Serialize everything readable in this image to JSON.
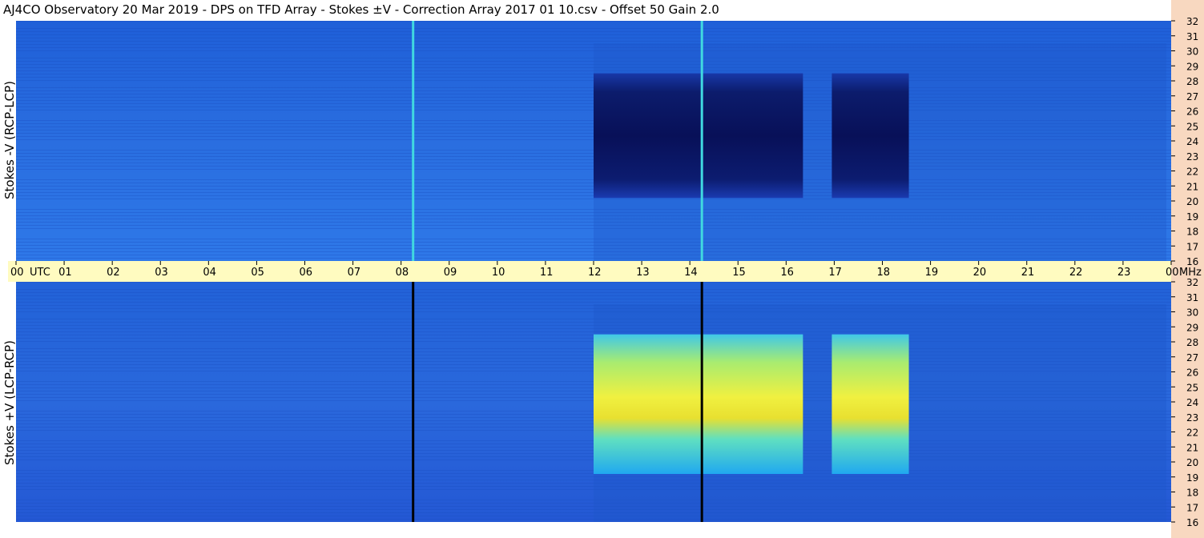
{
  "title": "AJ4CO Observatory  20 Mar 2019  -  DPS on TFD Array  -  Stokes ±V  -  Correction Array 2017 01 10.csv  -  Offset 50  Gain 2.0",
  "colors": {
    "background_blue": "#2a6ee0",
    "time_axis_band": "#fffbc0",
    "right_axis_strip": "#f8d8c0",
    "dark_event": "#0a1a5a",
    "yellow_event": "#f0e020"
  },
  "chart_data": {
    "type": "heatmap",
    "x_axis": {
      "label_unit": "UTC",
      "ticks": [
        "00",
        "01",
        "02",
        "03",
        "04",
        "05",
        "06",
        "07",
        "08",
        "09",
        "10",
        "11",
        "12",
        "13",
        "14",
        "15",
        "16",
        "17",
        "18",
        "19",
        "20",
        "21",
        "22",
        "23",
        "00"
      ],
      "range_hours": [
        0,
        24
      ]
    },
    "y_axis": {
      "unit": "MHz",
      "ticks": [
        "32",
        "31",
        "30",
        "29",
        "28",
        "27",
        "26",
        "25",
        "24",
        "23",
        "22",
        "21",
        "20",
        "19",
        "18",
        "17",
        "16"
      ],
      "range_mhz": [
        16,
        32
      ]
    },
    "panels": [
      {
        "name": "Stokes -V (RCP-LCP)",
        "event_style": "dark",
        "events": [
          {
            "start_utc": 12.0,
            "end_utc": 16.35,
            "low_mhz": 20.2,
            "high_mhz": 28.5
          },
          {
            "start_utc": 16.95,
            "end_utc": 18.55,
            "low_mhz": 20.2,
            "high_mhz": 28.5
          }
        ],
        "vertical_lines_utc": [
          8.25,
          14.25
        ]
      },
      {
        "name": "Stokes +V (LCP-RCP)",
        "event_style": "bright",
        "events": [
          {
            "start_utc": 12.0,
            "end_utc": 16.35,
            "low_mhz": 19.2,
            "high_mhz": 28.5
          },
          {
            "start_utc": 16.95,
            "end_utc": 18.55,
            "low_mhz": 19.2,
            "high_mhz": 28.5
          }
        ],
        "vertical_lines_utc": [
          8.25,
          14.25
        ]
      }
    ]
  }
}
